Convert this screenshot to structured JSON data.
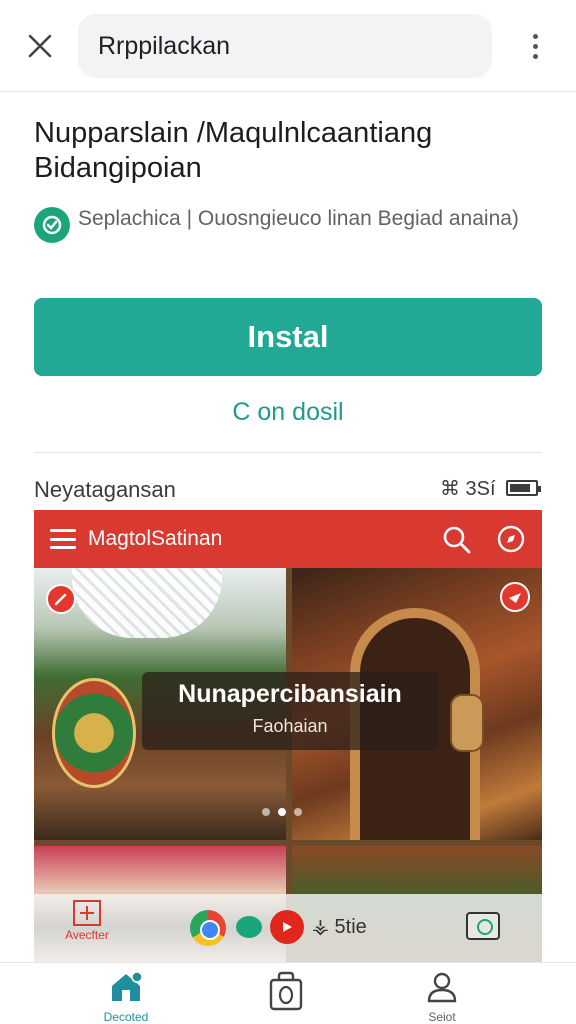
{
  "top_bar": {
    "search_text": "Rrppilackan"
  },
  "app": {
    "title": "Nupparslain /Maqulnlcaantiang Bidangipoian",
    "developer_line": "Seplachica | Ouosngieuco linan Begiad anaina)",
    "install_label": "Instal",
    "secondary_label": "C on dosil"
  },
  "section": {
    "title": "Neyatagansan",
    "meta": "⌘ 3Sí"
  },
  "preview": {
    "bar_title": "MagtolSatinan",
    "overlay_title": "Nunapercibansiain",
    "overlay_subtitle": "Faohaian",
    "dock_left_label": "Avecfter",
    "dock_text": "⚶ 5tie"
  },
  "bottom_nav": {
    "home_label": "Decoted",
    "profile_label": "Seiot"
  },
  "colors": {
    "accent": "#21a995",
    "preview_bar": "#d83a31",
    "home_icon": "#1f8fa0"
  },
  "icons": [
    "close-icon",
    "more-vert-icon",
    "developer-icon",
    "menu-icon",
    "search-icon",
    "compass-icon",
    "pin-icon",
    "share-icon",
    "plus-icon",
    "chrome-icon",
    "chat-icon",
    "youtube-icon",
    "camera-icon",
    "home-icon",
    "bag-icon",
    "account-icon"
  ]
}
